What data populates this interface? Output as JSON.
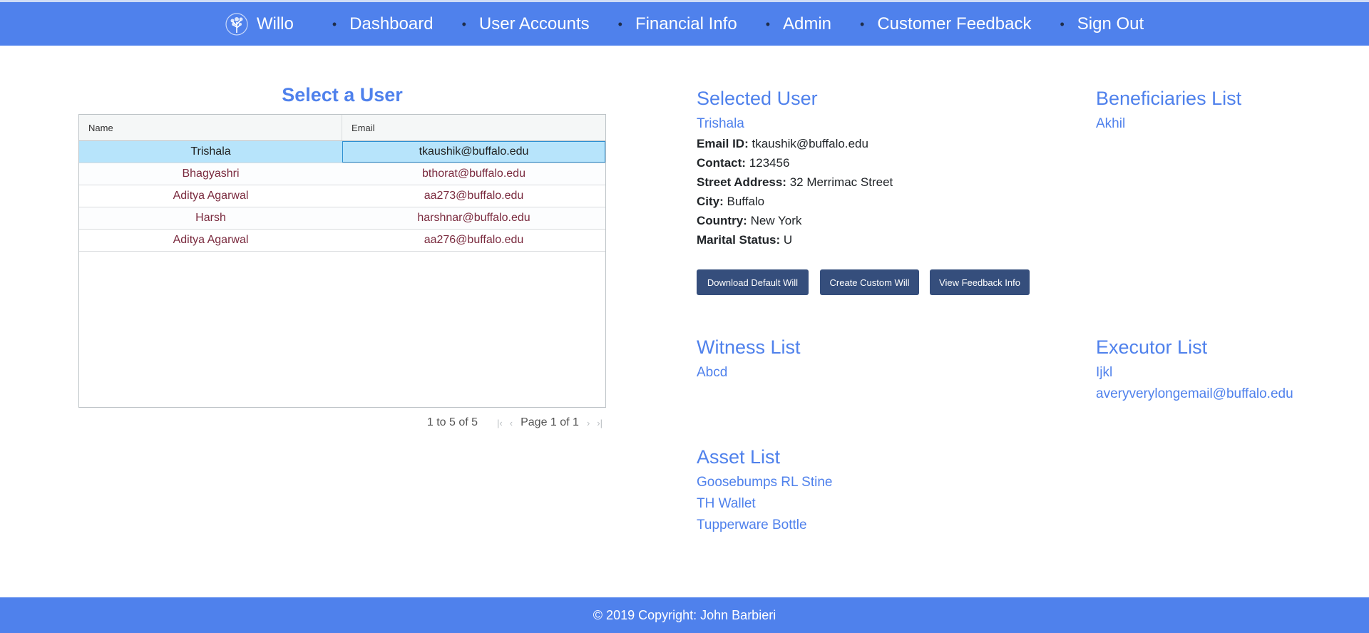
{
  "nav": {
    "brand": "Willo",
    "items": [
      "Dashboard",
      "User Accounts",
      "Financial Info",
      "Admin",
      "Customer Feedback",
      "Sign Out"
    ]
  },
  "user_grid": {
    "title": "Select a User",
    "columns": [
      "Name",
      "Email"
    ],
    "rows": [
      {
        "name": "Trishala",
        "email": "tkaushik@buffalo.edu",
        "selected": true
      },
      {
        "name": "Bhagyashri",
        "email": "bthorat@buffalo.edu"
      },
      {
        "name": "Aditya Agarwal",
        "email": "aa273@buffalo.edu"
      },
      {
        "name": "Harsh",
        "email": "harshnar@buffalo.edu"
      },
      {
        "name": "Aditya Agarwal",
        "email": "aa276@buffalo.edu"
      }
    ],
    "pager_summary": "1 to 5 of 5",
    "pager_page": "Page 1 of 1"
  },
  "selected_user": {
    "heading": "Selected User",
    "name": "Trishala",
    "fields": [
      {
        "label": "Email ID:",
        "value": "tkaushik@buffalo.edu"
      },
      {
        "label": "Contact:",
        "value": "123456"
      },
      {
        "label": "Street Address:",
        "value": "32 Merrimac Street"
      },
      {
        "label": "City:",
        "value": "Buffalo"
      },
      {
        "label": "Country:",
        "value": "New York"
      },
      {
        "label": "Marital Status:",
        "value": "U"
      }
    ],
    "buttons": [
      "Download Default Will",
      "Create Custom Will",
      "View Feedback Info"
    ]
  },
  "beneficiaries": {
    "heading": "Beneficiaries List",
    "items": [
      "Akhil"
    ]
  },
  "witnesses": {
    "heading": "Witness List",
    "items": [
      "Abcd"
    ]
  },
  "executors": {
    "heading": "Executor List",
    "items": [
      "Ijkl",
      "averyverylongemail@buffalo.edu"
    ]
  },
  "assets": {
    "heading": "Asset List",
    "items": [
      "Goosebumps RL Stine",
      "TH Wallet",
      "Tupperware Bottle"
    ]
  },
  "footer": {
    "text": "© 2019 Copyright: John Barbieri"
  },
  "colors": {
    "accent": "#4f81ec",
    "button": "#354e7c",
    "selected_row": "#b7e4fb"
  },
  "icons": {
    "brand": "tree-icon",
    "pager": [
      "first-page-icon",
      "prev-page-icon",
      "next-page-icon",
      "last-page-icon"
    ]
  }
}
